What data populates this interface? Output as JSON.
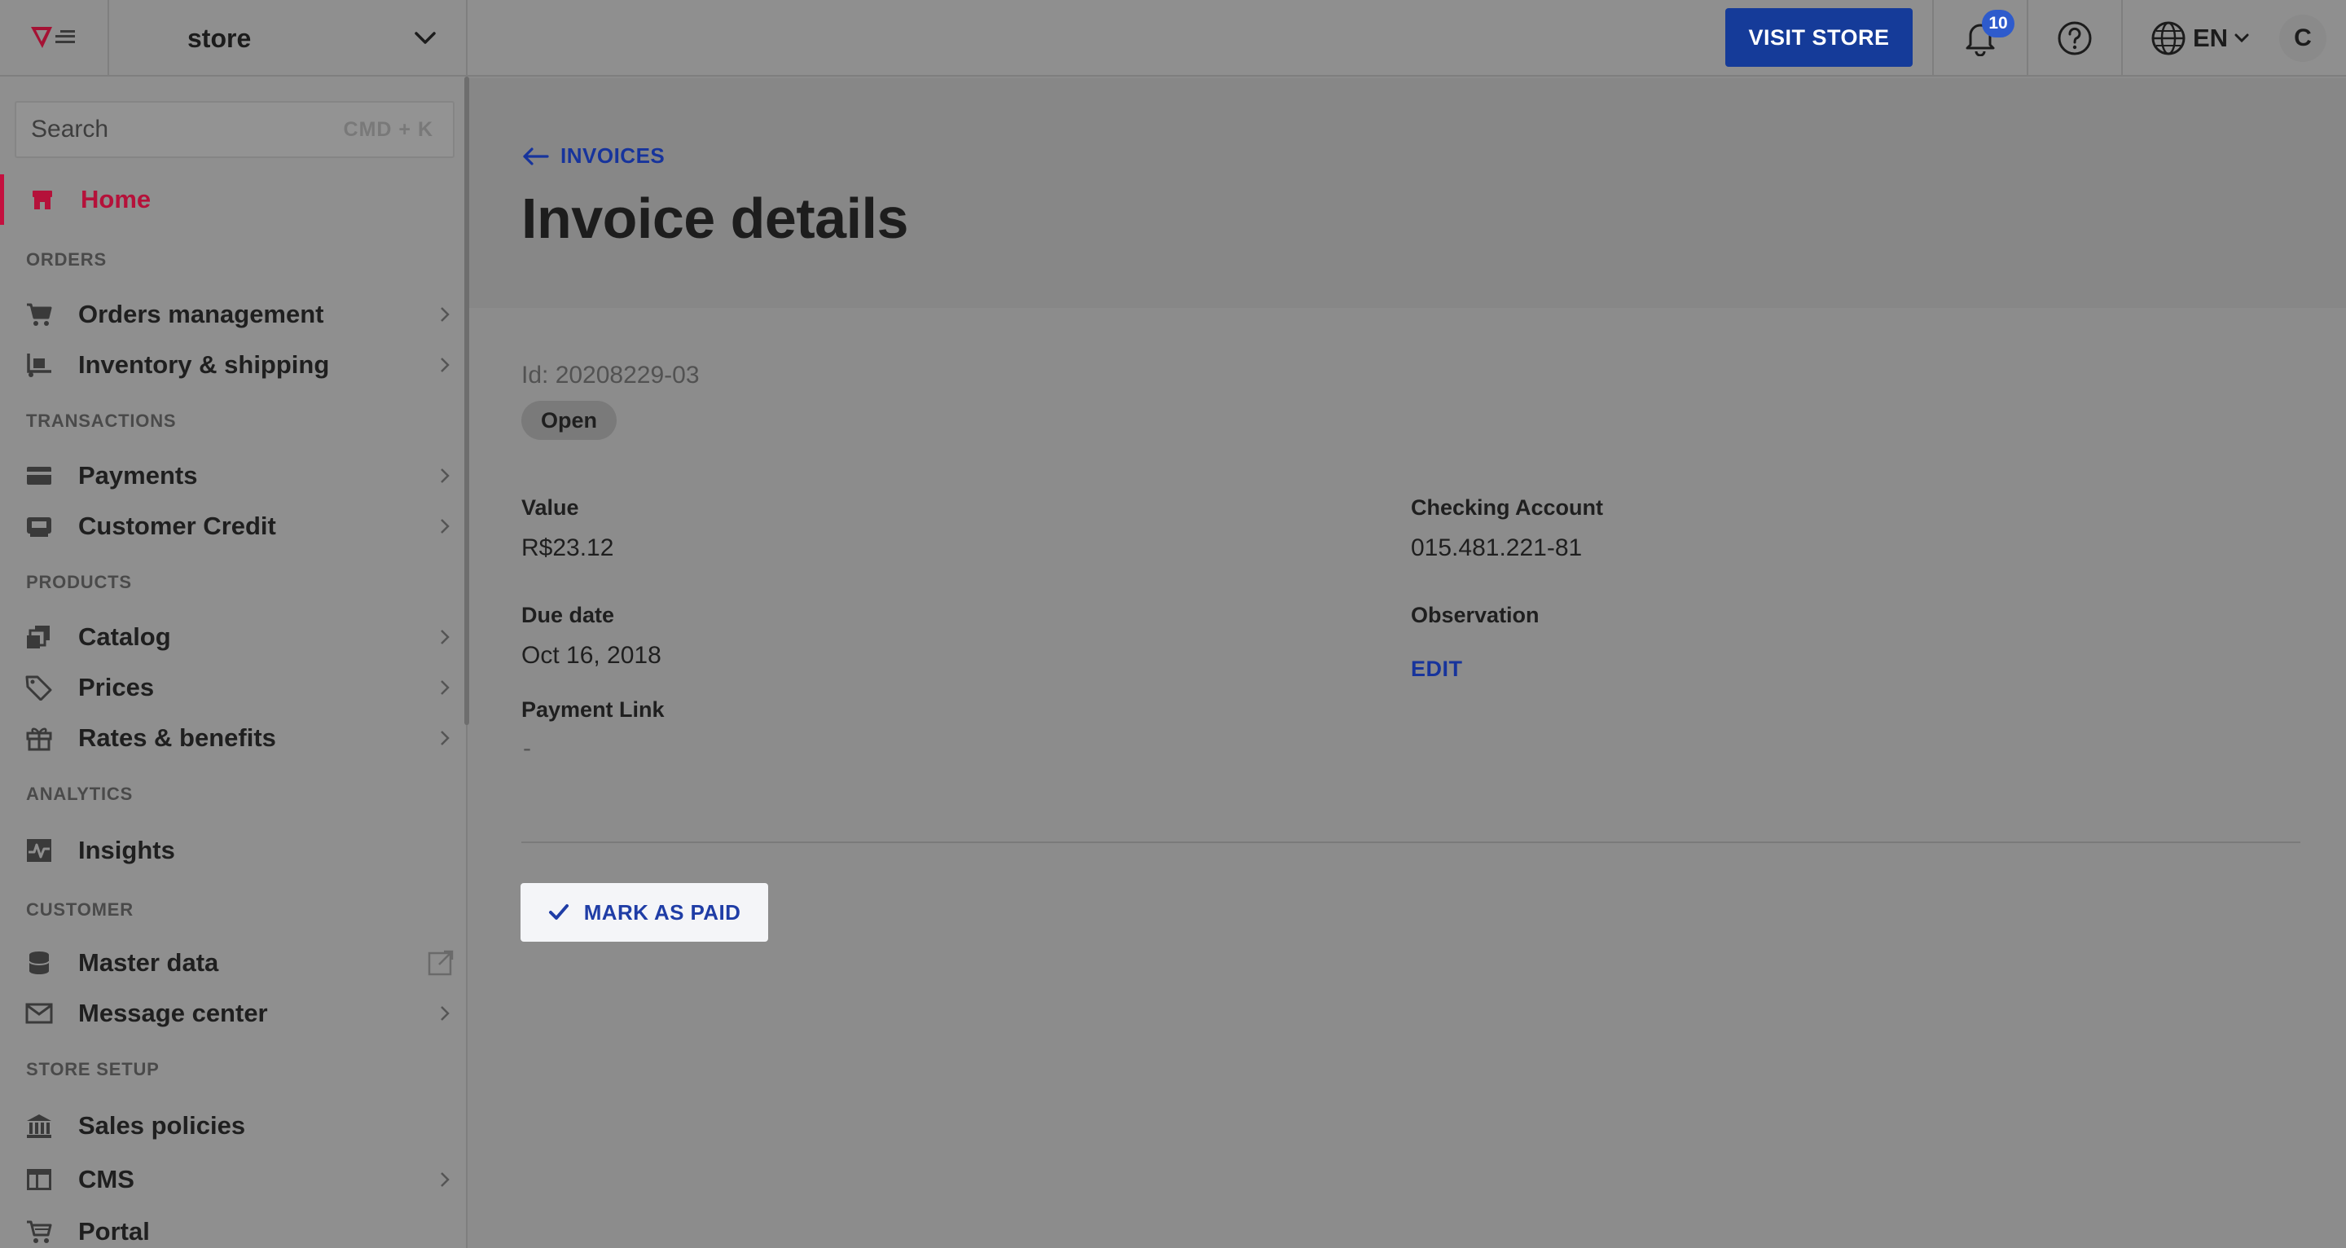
{
  "topbar": {
    "store_name": "store",
    "visit_store_label": "VISIT STORE",
    "notification_count": "10",
    "language": "EN",
    "user_initial": "C"
  },
  "sidebar": {
    "search_placeholder": "Search",
    "search_shortcut": "CMD + K",
    "home_label": "Home",
    "sections": {
      "orders": "ORDERS",
      "transactions": "TRANSACTIONS",
      "products": "PRODUCTS",
      "analytics": "ANALYTICS",
      "customer": "CUSTOMER",
      "store_setup": "STORE SETUP"
    },
    "items": {
      "orders_management": "Orders management",
      "inventory_shipping": "Inventory & shipping",
      "payments": "Payments",
      "customer_credit": "Customer Credit",
      "catalog": "Catalog",
      "prices": "Prices",
      "rates_benefits": "Rates & benefits",
      "insights": "Insights",
      "master_data": "Master data",
      "message_center": "Message center",
      "sales_policies": "Sales policies",
      "cms": "CMS",
      "portal": "Portal"
    }
  },
  "main": {
    "back_label": "INVOICES",
    "title": "Invoice details",
    "invoice_id": "Id: 20208229-03",
    "status": "Open",
    "value_label": "Value",
    "value": "R$23.12",
    "checking_account_label": "Checking Account",
    "checking_account": "015.481.221-81",
    "due_date_label": "Due date",
    "due_date": "Oct 16, 2018",
    "observation_label": "Observation",
    "edit_label": "EDIT",
    "payment_link_label": "Payment Link",
    "payment_link": "-",
    "mark_as_paid_label": "MARK AS PAID"
  },
  "colors": {
    "accent": "#153b99",
    "brand": "#c4103f",
    "overlay": "#8c8c8c"
  }
}
